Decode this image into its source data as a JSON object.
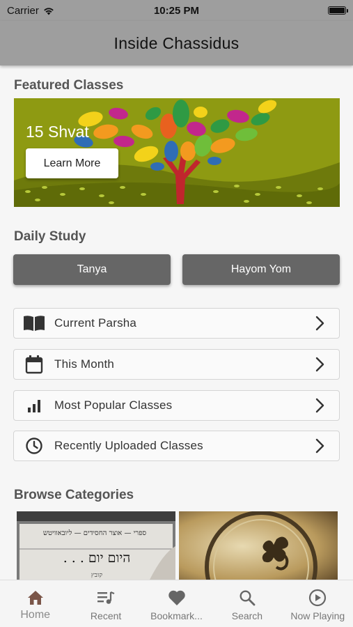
{
  "status_bar": {
    "carrier": "Carrier",
    "time": "10:25 PM"
  },
  "header": {
    "title": "Inside Chassidus"
  },
  "featured": {
    "section_title": "Featured Classes",
    "banner": {
      "title": "15 Shvat",
      "button_label": "Learn More"
    }
  },
  "daily_study": {
    "section_title": "Daily Study",
    "buttons": [
      {
        "label": "Tanya"
      },
      {
        "label": "Hayom Yom"
      }
    ]
  },
  "menu": {
    "items": [
      {
        "label": "Current Parsha",
        "icon": "open-book-icon"
      },
      {
        "label": "This Month",
        "icon": "calendar-icon"
      },
      {
        "label": "Most Popular Classes",
        "icon": "bar-chart-icon"
      },
      {
        "label": "Recently Uploaded Classes",
        "icon": "clock-icon"
      }
    ]
  },
  "categories": {
    "section_title": "Browse Categories",
    "items": [
      {
        "header_text": "ספרי — אוצר החסידים — ליובאוויטש",
        "title_text": "היום יום . . .",
        "sub_text": "קובץ"
      },
      {
        "icon": "ornate-clasp-icon"
      }
    ]
  },
  "tab_bar": {
    "active": "Home",
    "tabs": [
      {
        "label": "Home",
        "icon": "home-icon"
      },
      {
        "label": "Recent",
        "icon": "playlist-icon"
      },
      {
        "label": "Bookmark...",
        "icon": "heart-icon"
      },
      {
        "label": "Search",
        "icon": "search-icon"
      },
      {
        "label": "Now Playing",
        "icon": "play-circle-icon"
      }
    ]
  },
  "colors": {
    "header_bg": "#9e9e9e",
    "button_bg": "#666666",
    "banner_bg": "#8e9a12",
    "tab_active": "#7a5548"
  }
}
